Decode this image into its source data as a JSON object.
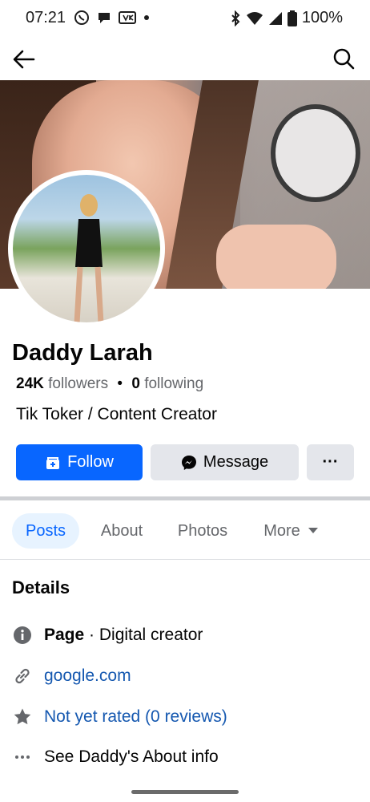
{
  "status_bar": {
    "time": "07:21",
    "battery": "100%",
    "icons": [
      "whatsapp-icon",
      "chat-bubble-icon",
      "vk-icon",
      "dot-icon",
      "bluetooth-icon",
      "wifi-icon",
      "signal-icon",
      "battery-icon"
    ]
  },
  "nav": {
    "back_icon": "arrow-left-icon",
    "search_icon": "search-icon"
  },
  "profile": {
    "name": "Daddy Larah",
    "followers_count": "24K",
    "followers_label": "followers",
    "separator": "•",
    "following_count": "0",
    "following_label": "following",
    "bio": "Tik Toker / Content Creator"
  },
  "actions": {
    "follow_label": "Follow",
    "message_label": "Message",
    "more_label": "···"
  },
  "tabs": [
    {
      "label": "Posts",
      "active": true
    },
    {
      "label": "About",
      "active": false
    },
    {
      "label": "Photos",
      "active": false
    },
    {
      "label": "More",
      "active": false
    }
  ],
  "details": {
    "title": "Details",
    "page_type_label": "Page",
    "page_type_value": " · Digital creator",
    "website": "google.com",
    "rating": "Not yet rated (0 reviews)",
    "about_link": "See Daddy's About info"
  },
  "colors": {
    "accent": "#0866ff",
    "tab_active_bg": "#e7f3ff",
    "button_secondary": "#e4e6eb",
    "link": "#1558b0",
    "muted_text": "#65676b"
  }
}
